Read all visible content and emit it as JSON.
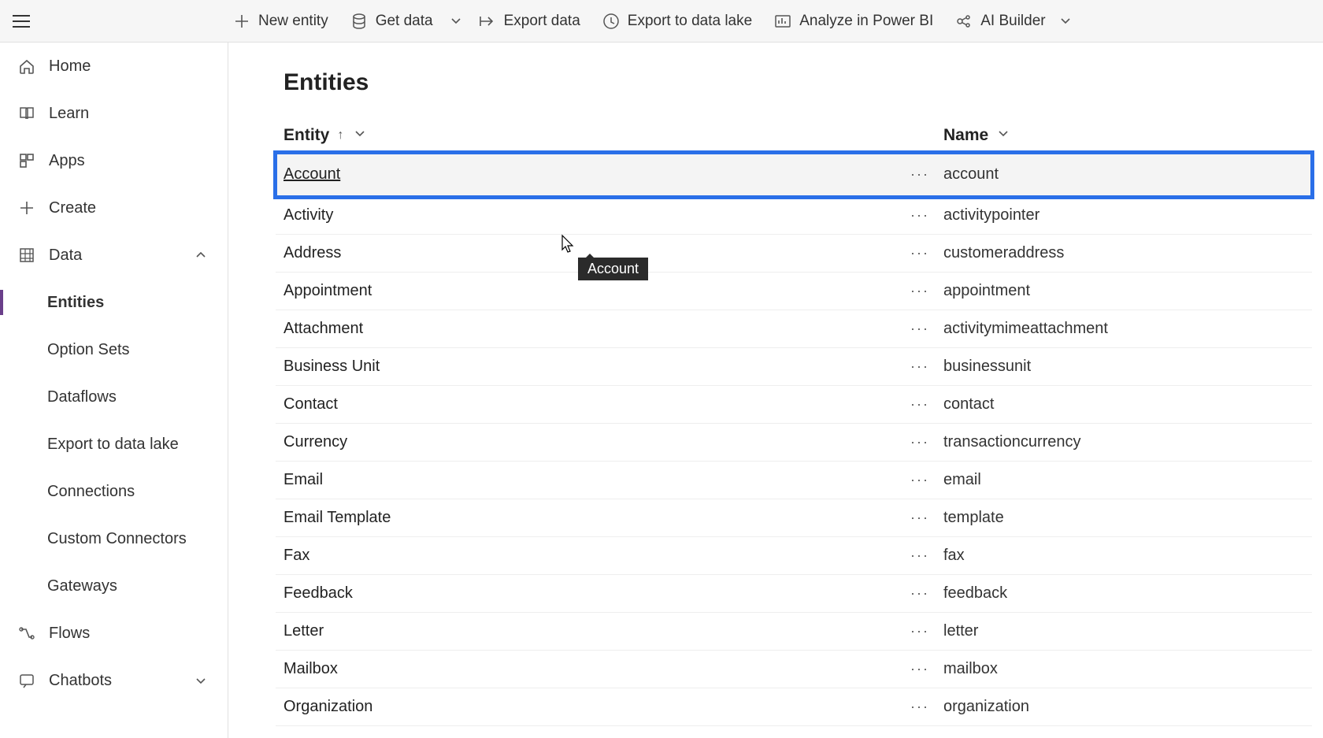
{
  "commandbar": {
    "new_entity": "New entity",
    "get_data": "Get data",
    "export_data": "Export data",
    "export_to_data_lake": "Export to data lake",
    "analyze_in_power_bi": "Analyze in Power BI",
    "ai_builder": "AI Builder"
  },
  "sidenav": {
    "home": "Home",
    "learn": "Learn",
    "apps": "Apps",
    "create": "Create",
    "data": "Data",
    "entities": "Entities",
    "option_sets": "Option Sets",
    "dataflows": "Dataflows",
    "export_to_data_lake": "Export to data lake",
    "connections": "Connections",
    "custom_connectors": "Custom Connectors",
    "gateways": "Gateways",
    "flows": "Flows",
    "chatbots": "Chatbots"
  },
  "page": {
    "title": "Entities",
    "col_entity": "Entity",
    "col_name": "Name",
    "tooltip": "Account"
  },
  "rows": [
    {
      "entity": "Account",
      "name": "account"
    },
    {
      "entity": "Activity",
      "name": "activitypointer"
    },
    {
      "entity": "Address",
      "name": "customeraddress"
    },
    {
      "entity": "Appointment",
      "name": "appointment"
    },
    {
      "entity": "Attachment",
      "name": "activitymimeattachment"
    },
    {
      "entity": "Business Unit",
      "name": "businessunit"
    },
    {
      "entity": "Contact",
      "name": "contact"
    },
    {
      "entity": "Currency",
      "name": "transactioncurrency"
    },
    {
      "entity": "Email",
      "name": "email"
    },
    {
      "entity": "Email Template",
      "name": "template"
    },
    {
      "entity": "Fax",
      "name": "fax"
    },
    {
      "entity": "Feedback",
      "name": "feedback"
    },
    {
      "entity": "Letter",
      "name": "letter"
    },
    {
      "entity": "Mailbox",
      "name": "mailbox"
    },
    {
      "entity": "Organization",
      "name": "organization"
    }
  ]
}
